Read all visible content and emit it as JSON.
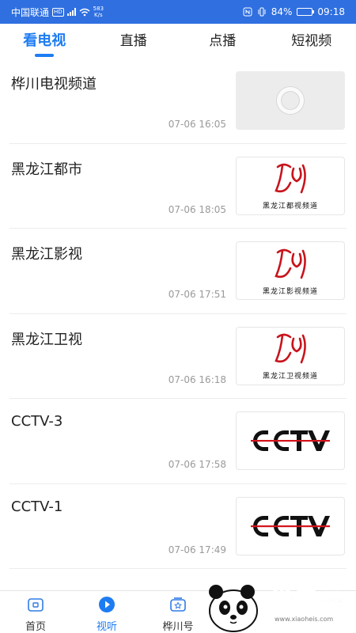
{
  "status_bar": {
    "carrier": "中国联通",
    "network_badge": "HD",
    "signal_type": "4G",
    "speed_value": "583",
    "speed_unit": "K/s",
    "battery_percent": "84%",
    "battery_level": 0.84,
    "time": "09:18"
  },
  "tabs": [
    {
      "label": "看电视",
      "active": true
    },
    {
      "label": "直播",
      "active": false
    },
    {
      "label": "点播",
      "active": false
    },
    {
      "label": "短视频",
      "active": false
    }
  ],
  "channels": [
    {
      "title": "桦川电视频道",
      "time": "07-06 16:05",
      "thumb": "placeholder"
    },
    {
      "title": "黑龙江都市",
      "time": "07-06 18:05",
      "thumb": "hlj",
      "caption": "黑龙江都视频道"
    },
    {
      "title": "黑龙江影视",
      "time": "07-06 17:51",
      "thumb": "hlj",
      "caption": "黑龙江影视频道"
    },
    {
      "title": "黑龙江卫视",
      "time": "07-06 16:18",
      "thumb": "hlj",
      "caption": "黑龙江卫视频道"
    },
    {
      "title": "CCTV-3",
      "time": "07-06 17:58",
      "thumb": "cctv"
    },
    {
      "title": "CCTV-1",
      "time": "07-06 17:49",
      "thumb": "cctv"
    }
  ],
  "bottom_nav": [
    {
      "label": "首页",
      "icon": "home-icon",
      "active": false
    },
    {
      "label": "视听",
      "icon": "play-icon",
      "active": true
    },
    {
      "label": "桦川号",
      "icon": "star-icon",
      "active": false
    },
    {
      "label": "",
      "icon": "hidden",
      "active": false
    },
    {
      "label": "",
      "icon": "hidden",
      "active": false
    }
  ],
  "colors": {
    "accent": "#1e7cf2",
    "status_bar": "#2f6fe0",
    "hlj_logo_red": "#c8141c"
  },
  "watermark": {
    "brand": "小黑",
    "sub": "游戏",
    "url": "www.xiaoheis.com"
  }
}
